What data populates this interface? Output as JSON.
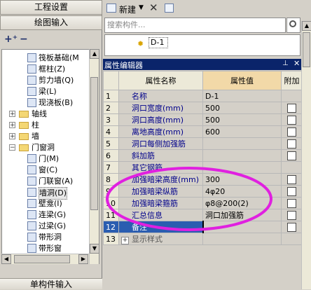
{
  "left": {
    "top_button": "工程设置",
    "second_button": "绘图输入",
    "bottom_tab": "单构件输入",
    "tree": [
      {
        "label": "筏板基础(M",
        "kind": "item"
      },
      {
        "label": "框柱(Z)",
        "kind": "item"
      },
      {
        "label": "剪力墙(Q)",
        "kind": "item"
      },
      {
        "label": "梁(L)",
        "kind": "item"
      },
      {
        "label": "现浇板(B)",
        "kind": "item"
      },
      {
        "label": "轴线",
        "kind": "folder"
      },
      {
        "label": "柱",
        "kind": "folder"
      },
      {
        "label": "墙",
        "kind": "folder"
      },
      {
        "label": "门窗洞",
        "kind": "folder-open"
      },
      {
        "label": "门(M)",
        "kind": "item"
      },
      {
        "label": "窗(C)",
        "kind": "item"
      },
      {
        "label": "门联窗(A)",
        "kind": "item"
      },
      {
        "label": "墙洞(D)",
        "kind": "item-selected"
      },
      {
        "label": "壁龛(I)",
        "kind": "item"
      },
      {
        "label": "连梁(G)",
        "kind": "item"
      },
      {
        "label": "过梁(G)",
        "kind": "item"
      },
      {
        "label": "带形洞",
        "kind": "item"
      },
      {
        "label": "带形窗",
        "kind": "item"
      },
      {
        "label": "梁",
        "kind": "folder"
      }
    ]
  },
  "right": {
    "toolbar": {
      "new_label": "新建"
    },
    "search_placeholder": "搜索构件...",
    "component": "D-1",
    "prop_header": "属性编辑器",
    "table": {
      "headers": [
        "属性名称",
        "属性值",
        "附加"
      ],
      "rows": [
        {
          "num": "1",
          "name": "名称",
          "value": "D-1",
          "check": false
        },
        {
          "num": "2",
          "name": "洞口宽度(mm)",
          "value": "500",
          "check": true
        },
        {
          "num": "3",
          "name": "洞口高度(mm)",
          "value": "500",
          "check": true
        },
        {
          "num": "4",
          "name": "离地高度(mm)",
          "value": "600",
          "check": true
        },
        {
          "num": "5",
          "name": "洞口每侧加强筋",
          "value": "",
          "check": true
        },
        {
          "num": "6",
          "name": "斜加筋",
          "value": "",
          "check": true
        },
        {
          "num": "7",
          "name": "其它钢筋",
          "value": "",
          "check": false
        },
        {
          "num": "8",
          "name": "加强暗梁高度(mm)",
          "value": "300",
          "check": true
        },
        {
          "num": "9",
          "name": "加强暗梁纵筋",
          "value": "4φ20",
          "check": true
        },
        {
          "num": "10",
          "name": "加强暗梁箍筋",
          "value": "φ8@200(2)",
          "check": true
        },
        {
          "num": "11",
          "name": "汇总信息",
          "value": "洞口加强筋",
          "check": true
        },
        {
          "num": "12",
          "name": "备注",
          "value": "",
          "check": true,
          "active": true
        },
        {
          "num": "13",
          "name": "显示样式",
          "value": "",
          "check": false,
          "expand": true
        }
      ]
    }
  }
}
